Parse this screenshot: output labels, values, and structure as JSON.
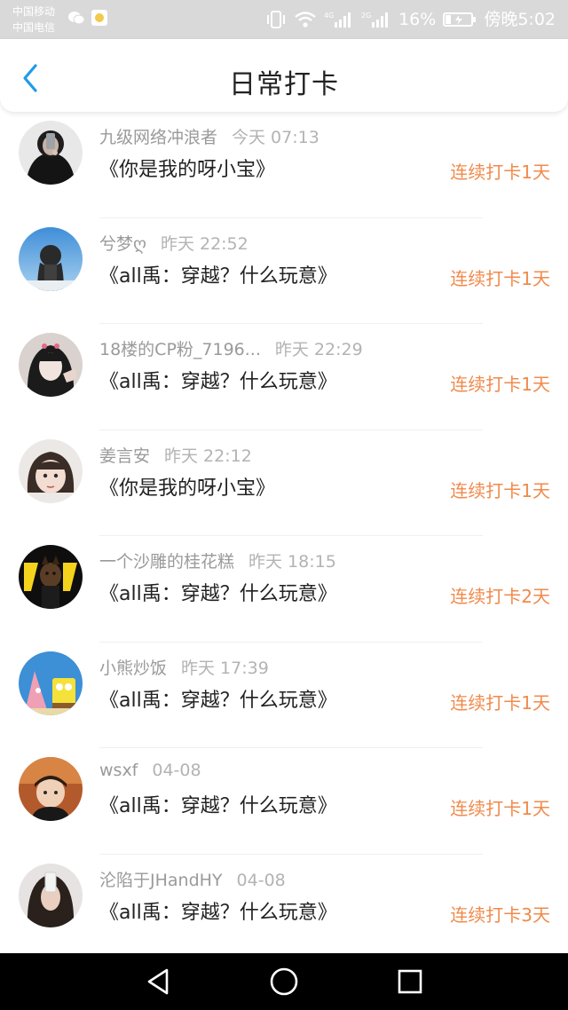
{
  "status_bar": {
    "carrier_1": "中国移动",
    "carrier_2": "中国电信",
    "battery": "16%",
    "time": "傍晚5:02",
    "signal_1": "4G",
    "signal_2": "2G"
  },
  "header": {
    "title": "日常打卡",
    "back_icon": "chevron-left-icon"
  },
  "checkins": [
    {
      "name": "九级网络冲浪者",
      "time": "今天 07:13",
      "book": "《你是我的呀小宝》",
      "streak": "连续打卡1天"
    },
    {
      "name": "兮梦ღ",
      "time": "昨天 22:52",
      "book": "《all禹：穿越？什么玩意》",
      "streak": "连续打卡1天"
    },
    {
      "name": "18楼的CP粉_7196...",
      "time": "昨天 22:29",
      "book": "《all禹：穿越？什么玩意》",
      "streak": "连续打卡1天"
    },
    {
      "name": "姜言安",
      "time": "昨天 22:12",
      "book": "《你是我的呀小宝》",
      "streak": "连续打卡1天"
    },
    {
      "name": "一个沙雕的桂花糕",
      "time": "昨天 18:15",
      "book": "《all禹：穿越？什么玩意》",
      "streak": "连续打卡2天"
    },
    {
      "name": "小熊炒饭",
      "time": "昨天 17:39",
      "book": "《all禹：穿越？什么玩意》",
      "streak": "连续打卡1天"
    },
    {
      "name": "wsxf",
      "time": "04-08",
      "book": "《all禹：穿越？什么玩意》",
      "streak": "连续打卡1天"
    },
    {
      "name": "沦陷于JHandHY",
      "time": "04-08",
      "book": "《all禹：穿越？什么玩意》",
      "streak": "连续打卡3天"
    }
  ],
  "colors": {
    "accent_orange": "#f08a4b",
    "back_blue": "#1e9be9",
    "status_bar_bg": "#d9d9d9"
  },
  "nav": {
    "back": "triangle-back-icon",
    "home": "circle-home-icon",
    "recents": "square-recents-icon"
  }
}
